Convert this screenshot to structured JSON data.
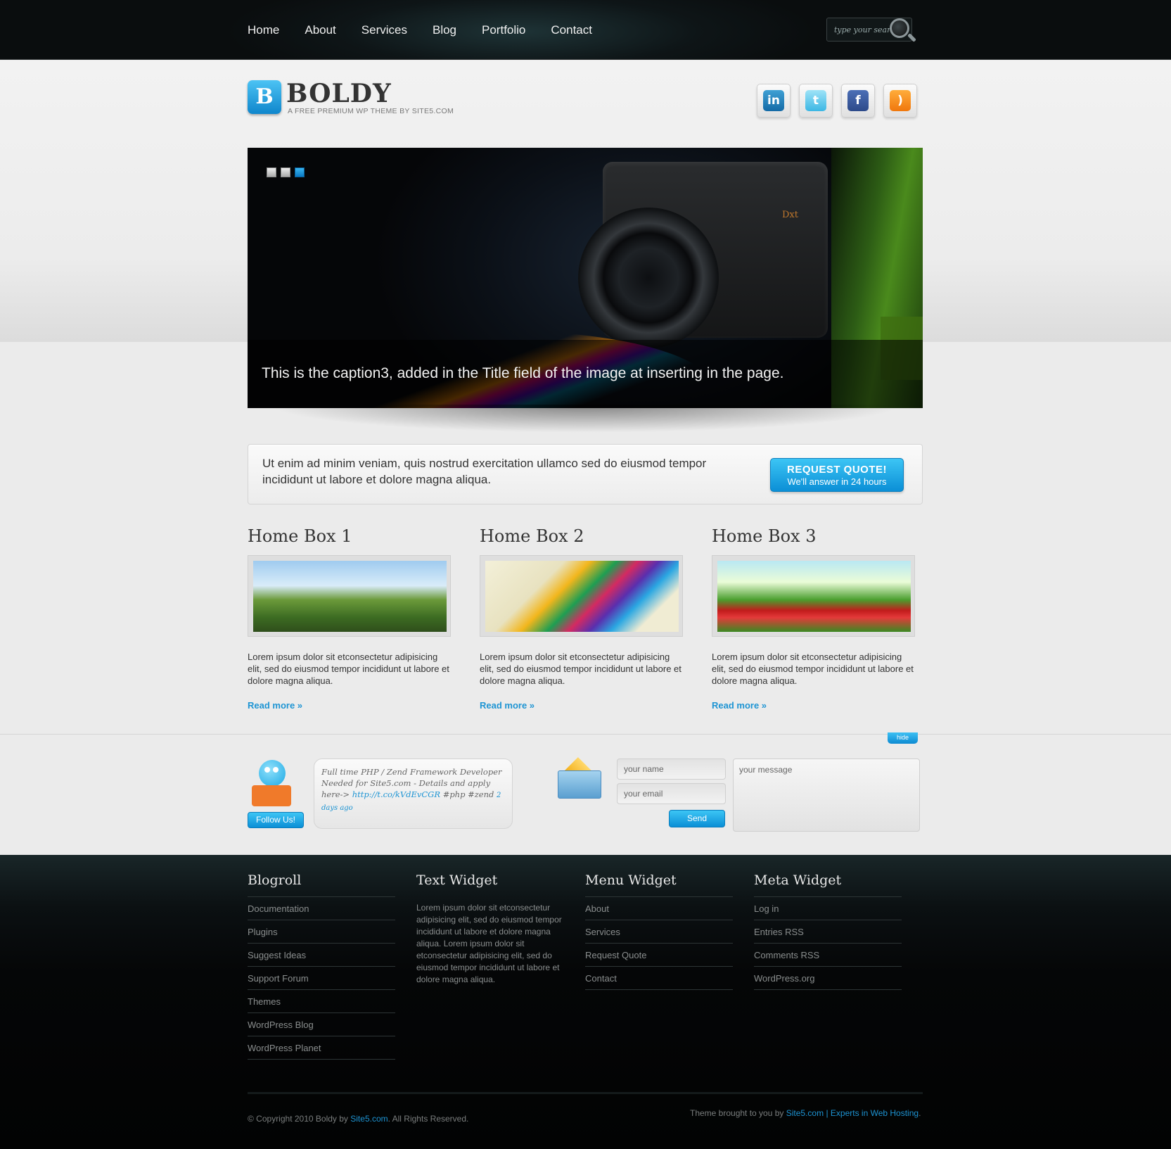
{
  "nav": {
    "items": [
      "Home",
      "About",
      "Services",
      "Blog",
      "Portfolio",
      "Contact"
    ],
    "search_placeholder": "type your search"
  },
  "header": {
    "logo_letter": "B",
    "title": "BOLDY",
    "tagline": "A FREE PREMIUM WP THEME BY SITE5.COM",
    "socials": [
      "linkedin-icon",
      "twitter-icon",
      "facebook-icon",
      "rss-icon"
    ],
    "social_glyphs": {
      "linkedin": "in",
      "twitter": "t",
      "facebook": "f",
      "rss": ")"
    }
  },
  "slider": {
    "camera_label": "Dxt",
    "caption": "This is the caption3, added in the Title field of the image at inserting in the page.",
    "dots": 3,
    "active_dot": 3
  },
  "quote": {
    "text": "Ut enim ad minim veniam, quis nostrud exercitation ullamco sed do eiusmod tempor incididunt ut labore et dolore magna aliqua.",
    "button_title": "REQUEST QUOTE!",
    "button_sub": "We'll answer in 24 hours"
  },
  "home_boxes": [
    {
      "title": "Home Box 1",
      "text": "Lorem ipsum dolor sit etconsectetur adipisicing elit, sed do eiusmod tempor incididunt ut labore et dolore magna aliqua.",
      "more": "Read more »"
    },
    {
      "title": "Home Box 2",
      "text": "Lorem ipsum dolor sit etconsectetur adipisicing elit, sed do eiusmod tempor incididunt ut labore et dolore magna aliqua.",
      "more": "Read more »"
    },
    {
      "title": "Home Box 3",
      "text": "Lorem ipsum dolor sit etconsectetur adipisicing elit, sed do eiusmod tempor incididunt ut labore et dolore magna aliqua.",
      "more": "Read more »"
    }
  ],
  "bottom": {
    "hide_label": "hide",
    "follow_label": "Follow Us!",
    "tweet_text": "Full time PHP / Zend Framework Developer Needed for Site5.com - Details and apply here->",
    "tweet_link": "http://t.co/kVdEvCGR",
    "tweet_tags": "#php #zend",
    "tweet_time": "2 days ago",
    "name_placeholder": "your name",
    "email_placeholder": "your email",
    "message_placeholder": "your message",
    "send_label": "Send"
  },
  "footer": {
    "blogroll": {
      "title": "Blogroll",
      "items": [
        "Documentation",
        "Plugins",
        "Suggest Ideas",
        "Support Forum",
        "Themes",
        "WordPress Blog",
        "WordPress Planet"
      ]
    },
    "text_widget": {
      "title": "Text Widget",
      "text": "Lorem ipsum dolor sit etconsectetur adipisicing elit, sed do eiusmod tempor incididunt ut labore et dolore magna aliqua. Lorem ipsum dolor sit etconsectetur adipisicing elit, sed do eiusmod tempor incididunt ut labore et dolore magna aliqua."
    },
    "menu_widget": {
      "title": "Menu Widget",
      "items": [
        "About",
        "Services",
        "Request Quote",
        "Contact"
      ]
    },
    "meta_widget": {
      "title": "Meta Widget",
      "items": [
        "Log in",
        "Entries RSS",
        "Comments RSS",
        "WordPress.org"
      ]
    },
    "copyright_pre": "© Copyright 2010 Boldy by ",
    "copyright_link": "Site5.com",
    "copyright_post": ". All Rights Reserved.",
    "credit_pre": "Theme brought to you by ",
    "credit_link": "Site5.com | Experts in Web Hosting",
    "credit_post": "."
  },
  "colors": {
    "accent": "#1d94d3",
    "topbar": "#0e1517",
    "footer": "#050607"
  }
}
